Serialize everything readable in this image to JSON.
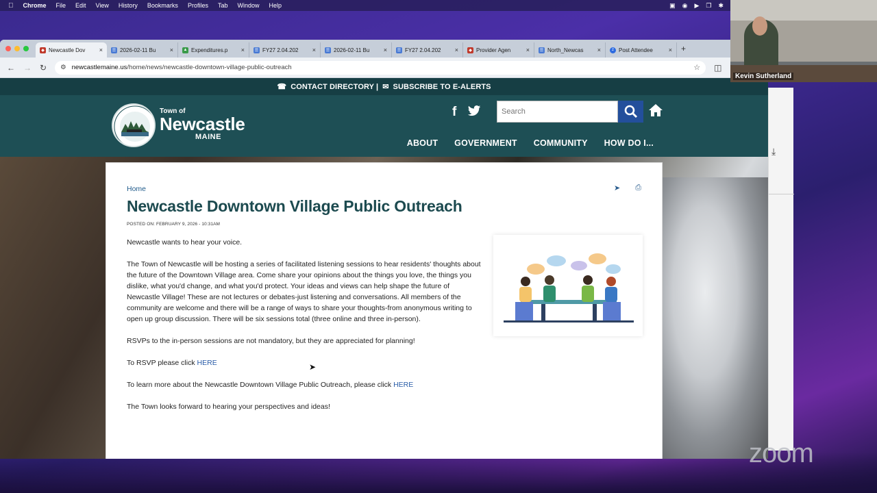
{
  "menubar": {
    "app": "Chrome",
    "items": [
      "File",
      "Edit",
      "View",
      "History",
      "Bookmarks",
      "Profiles",
      "Tab",
      "Window",
      "Help"
    ]
  },
  "browser": {
    "tabs": [
      {
        "label": "Newcastle Dov",
        "color": "#c0392b"
      },
      {
        "label": "2026-02-11 Bu",
        "color": "#4a7bd4"
      },
      {
        "label": "Expenditures.p",
        "color": "#3a9b4a"
      },
      {
        "label": "FY27 2.04.202",
        "color": "#4a7bd4"
      },
      {
        "label": "2026-02-11 Bu",
        "color": "#4a7bd4"
      },
      {
        "label": "FY27 2.04.202",
        "color": "#4a7bd4"
      },
      {
        "label": "Provider Agen",
        "color": "#c0392b"
      },
      {
        "label": "North_Newcas",
        "color": "#4a7bd4"
      },
      {
        "label": "Post Attendee",
        "color": "#2d6be0"
      }
    ],
    "url_host": "newcastlemaine.us",
    "url_path": "/home/news/newcastle-downtown-village-public-outreach"
  },
  "site": {
    "topbar": {
      "contact": "CONTACT DIRECTORY |",
      "subscribe": "SUBSCRIBE TO E-ALERTS"
    },
    "logo": {
      "town_of": "Town of",
      "name": "Newcastle",
      "state": "MAINE"
    },
    "search_placeholder": "Search",
    "nav": [
      "ABOUT",
      "GOVERNMENT",
      "COMMUNITY",
      "HOW DO I..."
    ],
    "breadcrumb": "Home",
    "article": {
      "title": "Newcastle Downtown Village Public Outreach",
      "posted": "POSTED ON: FEBRUARY 9, 2026 - 10:31AM",
      "p1": "Newcastle wants to hear your voice.",
      "p2": "The Town of Newcastle will be hosting a series of facilitated listening sessions to hear residents' thoughts about the future of the Downtown Village area. Come share your opinions about the things you love, the things you dislike, what you'd change, and what you'd protect. Your ideas and views can help shape the future of Newcastle Village! These are not lectures or debates-just listening and conversations. All members of the community are welcome and there will be a range of ways to share your thoughts-from anonymous writing to open up group discussion. There will be six sessions total (three online and three in-person).",
      "p3": "RSVPs to the in-person sessions are not mandatory, but they are appreciated for planning!",
      "p4_text": "To RSVP please click ",
      "p4_link": "HERE",
      "p5_text": "To learn more about the Newcastle Downtown Village Public Outreach, please click ",
      "p5_link": "HERE",
      "p6": "The Town looks forward to hearing your perspectives and ideas!"
    }
  },
  "zoom": {
    "participant_name": "Kevin Sutherland",
    "logo": "zoom"
  },
  "colors": {
    "header": "#1e4f55",
    "topbar": "#163e44",
    "title": "#1c4a4f",
    "link": "#2a5da8",
    "search_button": "#234f9c"
  }
}
